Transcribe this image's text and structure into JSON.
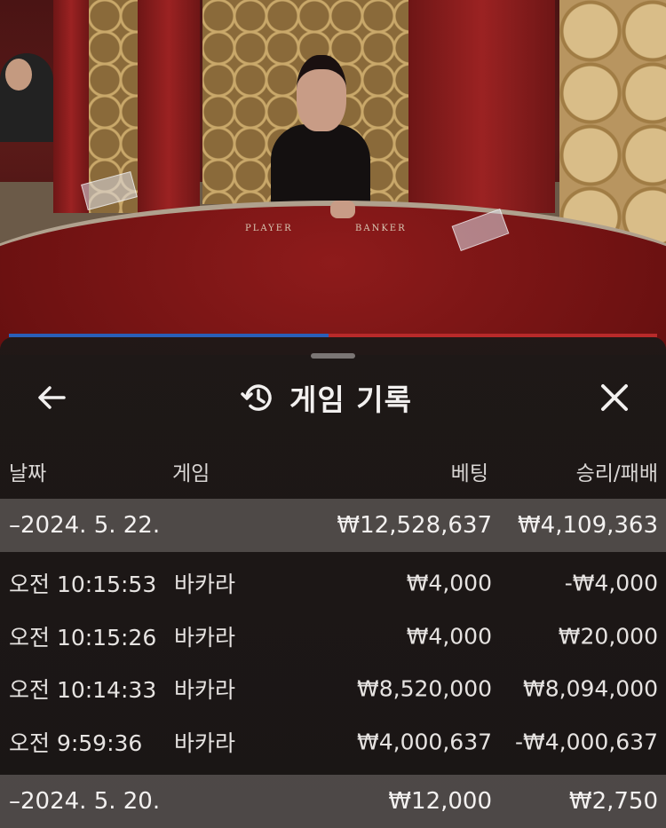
{
  "video": {
    "table_labels": {
      "player": "PLAYER",
      "banker": "BANKER"
    }
  },
  "history": {
    "title": "게임 기록",
    "icons": {
      "back": "back-arrow-icon",
      "title": "history-clock-icon",
      "close": "close-icon"
    },
    "columns": {
      "date": "날짜",
      "game": "게임",
      "bet": "베팅",
      "result": "승리/패배"
    },
    "groups": [
      {
        "date": "–2024. 5. 22.",
        "bet_total": "₩12,528,637",
        "result_total": "₩4,109,363",
        "rows": [
          {
            "time": "오전 10:15:53",
            "game": "바카라",
            "bet": "₩4,000",
            "result": "-₩4,000"
          },
          {
            "time": "오전 10:15:26",
            "game": "바카라",
            "bet": "₩4,000",
            "result": "₩20,000"
          },
          {
            "time": "오전 10:14:33",
            "game": "바카라",
            "bet": "₩8,520,000",
            "result": "₩8,094,000"
          },
          {
            "time": "오전 9:59:36",
            "game": "바카라",
            "bet": "₩4,000,637",
            "result": "-₩4,000,637"
          }
        ]
      },
      {
        "date": "–2024. 5. 20.",
        "bet_total": "₩12,000",
        "result_total": "₩2,750",
        "rows": []
      }
    ]
  }
}
